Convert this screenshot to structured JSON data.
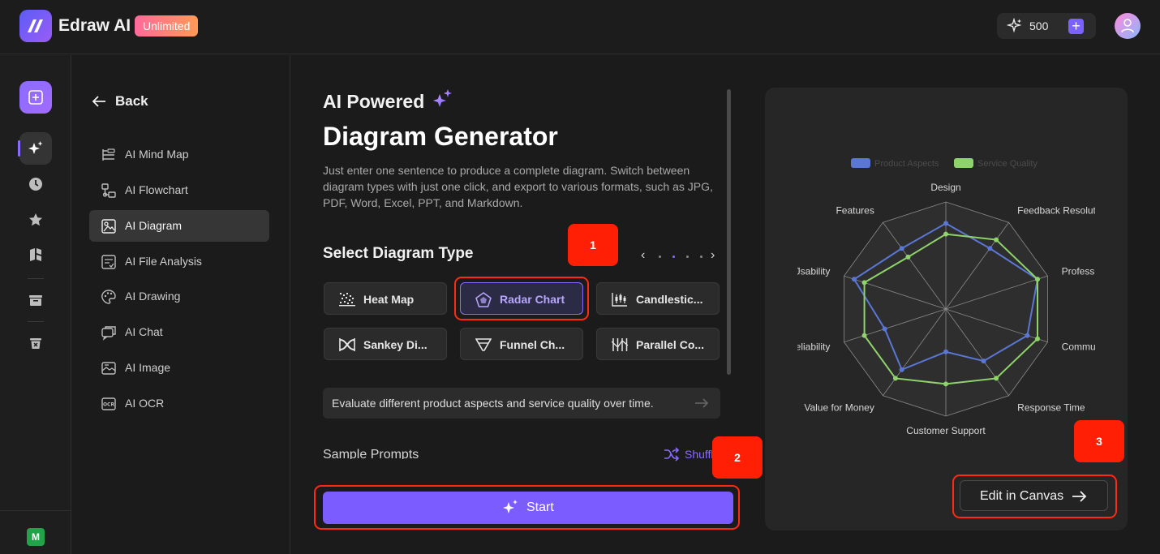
{
  "app": {
    "name": "Edraw AI",
    "plan_badge": "Unlimited",
    "credits": "500",
    "plus": "+"
  },
  "rail": {
    "items": [
      "new-icon",
      "ai-sparkle-icon",
      "clock-icon",
      "star-icon",
      "template-icon",
      "folder-icon",
      "trash-icon"
    ],
    "workspace_initial": "M"
  },
  "nav": {
    "back_label": "Back",
    "items": [
      {
        "label": "AI Mind Map",
        "icon": "mindmap-icon"
      },
      {
        "label": "AI Flowchart",
        "icon": "flowchart-icon"
      },
      {
        "label": "AI Diagram",
        "icon": "diagram-icon",
        "active": true
      },
      {
        "label": "AI File Analysis",
        "icon": "file-analysis-icon"
      },
      {
        "label": "AI Drawing",
        "icon": "palette-icon"
      },
      {
        "label": "AI Chat",
        "icon": "chat-icon"
      },
      {
        "label": "AI Image",
        "icon": "image-icon"
      },
      {
        "label": "AI OCR",
        "icon": "ocr-icon"
      }
    ]
  },
  "main": {
    "eyebrow": "AI Powered",
    "title": "Diagram Generator",
    "description": "Just enter one sentence to produce a complete diagram. Switch between diagram types with just one click, and export to various formats, such as JPG, PDF, Word, Excel, PPT, and Markdown.",
    "section_title": "Select Diagram Type",
    "pager_prev": "‹",
    "pager_next": "›",
    "types": [
      {
        "label": "Heat Map",
        "icon": "heatmap-icon"
      },
      {
        "label": "Radar Chart",
        "icon": "radar-icon",
        "selected": true
      },
      {
        "label": "Candlestic...",
        "icon": "candlestick-icon"
      },
      {
        "label": "Sankey Di...",
        "icon": "sankey-icon"
      },
      {
        "label": "Funnel Ch...",
        "icon": "funnel-icon"
      },
      {
        "label": "Parallel Co...",
        "icon": "parallel-icon"
      }
    ],
    "prompt": "Evaluate different product aspects and service quality over time.",
    "sample_prompts_label": "Sample Prompts",
    "shuffle_label": "Shuffle",
    "start_label": "Start"
  },
  "markers": [
    "1",
    "2",
    "3"
  ],
  "preview": {
    "edit_label": "Edit in Canvas",
    "chart_data": {
      "type": "radar",
      "series_colors": [
        "#5b77d6",
        "#8fd36b"
      ],
      "categories_shown": [
        "Design",
        "Feedback Resolut",
        "Profess",
        "Commu",
        "Response Time",
        "Customer Support",
        "Value for Money",
        "eliability",
        "Jsability",
        "Features"
      ],
      "legend": [
        "Product Aspects",
        "Service Quality"
      ],
      "rings": 10,
      "series": [
        {
          "name": "Product Aspects",
          "values": [
            8,
            7,
            9,
            8,
            6,
            4,
            7,
            6,
            9,
            7
          ]
        },
        {
          "name": "Service Quality",
          "values": [
            7,
            8,
            9,
            9,
            8,
            7,
            8,
            8,
            8,
            6
          ]
        }
      ]
    }
  }
}
